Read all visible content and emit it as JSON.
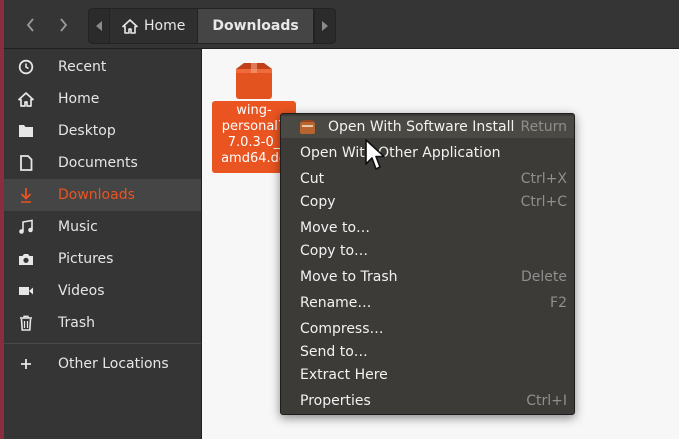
{
  "colors": {
    "accent": "#e95420",
    "headerbar": "#353535",
    "sidebar": "#353535",
    "menu": "#3c3b37"
  },
  "header": {
    "back_icon": "chevron-left-icon",
    "forward_icon": "chevron-right-icon",
    "path": [
      {
        "label": "Home",
        "icon": "home-icon"
      },
      {
        "label": "Downloads"
      }
    ]
  },
  "sidebar": {
    "items": [
      {
        "label": "Recent",
        "icon": "clock-icon"
      },
      {
        "label": "Home",
        "icon": "home-icon"
      },
      {
        "label": "Desktop",
        "icon": "folder-icon"
      },
      {
        "label": "Documents",
        "icon": "document-icon"
      },
      {
        "label": "Downloads",
        "icon": "download-icon",
        "active": true
      },
      {
        "label": "Music",
        "icon": "music-icon"
      },
      {
        "label": "Pictures",
        "icon": "camera-icon"
      },
      {
        "label": "Videos",
        "icon": "video-icon"
      },
      {
        "label": "Trash",
        "icon": "trash-icon"
      },
      {
        "label": "Other Locations",
        "icon": "plus-icon"
      }
    ]
  },
  "files": [
    {
      "name_lines": [
        "wing-",
        "personal7",
        "7.0.3-0_",
        "amd64.de"
      ],
      "icon": "package-icon",
      "selected": true
    }
  ],
  "context_menu": {
    "items": [
      {
        "label": "Open With Software Install",
        "accel": "Return",
        "icon": "package-icon"
      },
      {
        "label": "Open With Other Application",
        "accel": ""
      },
      {
        "label": "Cut",
        "accel": "Ctrl+X"
      },
      {
        "label": "Copy",
        "accel": "Ctrl+C"
      },
      {
        "label": "Move to…",
        "accel": ""
      },
      {
        "label": "Copy to…",
        "accel": ""
      },
      {
        "label": "Move to Trash",
        "accel": "Delete"
      },
      {
        "label": "Rename…",
        "accel": "F2"
      },
      {
        "label": "Compress…",
        "accel": ""
      },
      {
        "label": "Send to…",
        "accel": ""
      },
      {
        "label": "Extract Here",
        "accel": ""
      },
      {
        "label": "Properties",
        "accel": "Ctrl+I"
      }
    ]
  }
}
